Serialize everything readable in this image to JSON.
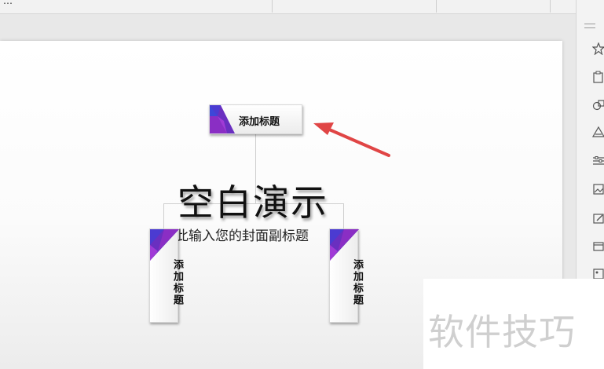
{
  "slide": {
    "main_title": "空白演示",
    "subtitle": "在此输入您的封面副标题",
    "top_box_label": "添加标题",
    "left_box_label": "添加标题",
    "right_box_label": "添加标题"
  },
  "watermark": "软件技巧",
  "colors": {
    "accent_purple": "#6a2fc0",
    "arrow_red": "#e04545"
  },
  "side_icons": [
    "star-icon",
    "clipboard-icon",
    "shapes-icon",
    "warning-icon",
    "sliders-icon",
    "image-icon",
    "picture-edit-icon",
    "box-icon",
    "gallery-icon"
  ]
}
